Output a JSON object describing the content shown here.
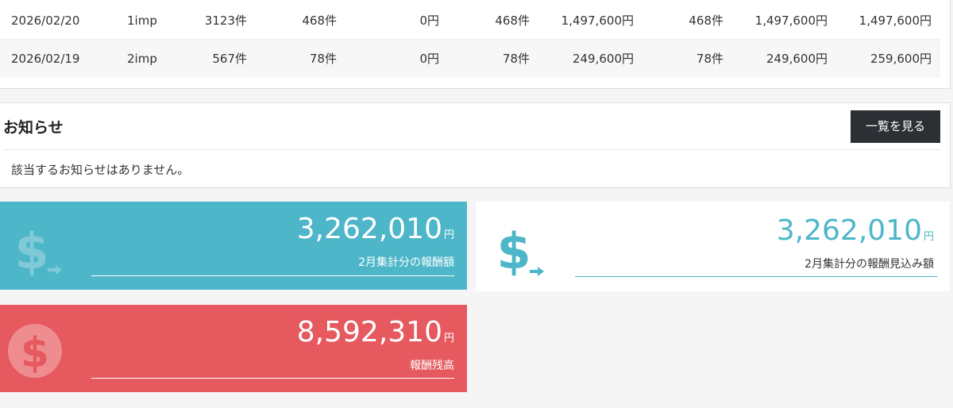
{
  "table": {
    "rows": [
      [
        "2026/02/20",
        "1imp",
        "3123件",
        "468件",
        "0円",
        "468件",
        "1,497,600円",
        "468件",
        "1,497,600円",
        "1,497,600円"
      ],
      [
        "2026/02/19",
        "2imp",
        "567件",
        "78件",
        "0円",
        "78件",
        "249,600円",
        "78件",
        "249,600円",
        "259,600円"
      ]
    ]
  },
  "notice": {
    "title": "お知らせ",
    "view_all_label": "一覧を見る",
    "empty_message": "該当するお知らせはありません。"
  },
  "cards": {
    "monthly_reward": {
      "amount": "3,262,010",
      "unit": "円",
      "label": "2月集計分の報酬額",
      "icon": "dollar-transfer-icon"
    },
    "estimated_reward": {
      "amount": "3,262,010",
      "unit": "円",
      "label": "2月集計分の報酬見込み額",
      "icon": "dollar-transfer-icon"
    },
    "reward_balance": {
      "amount": "8,592,310",
      "unit": "円",
      "label": "報酬残高",
      "icon": "dollar-coin-icon"
    }
  },
  "colors": {
    "teal": "#4db6c8",
    "red": "#e5595f",
    "dark_button": "#2c3035"
  }
}
